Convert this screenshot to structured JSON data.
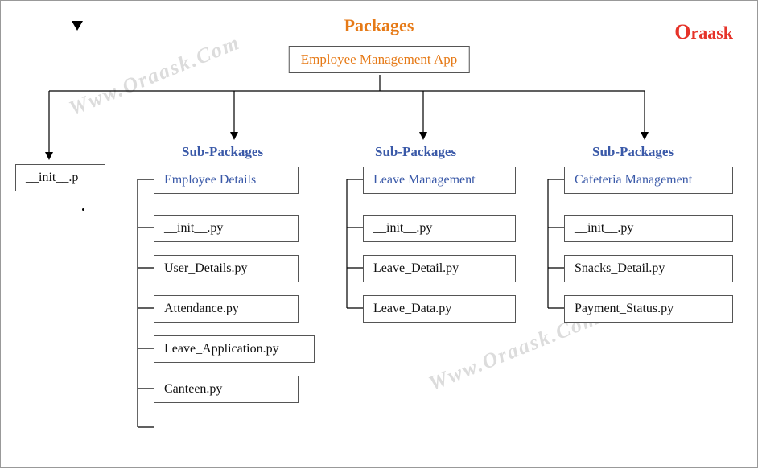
{
  "title": "Packages",
  "logo": "Oraask",
  "root": "Employee Management App",
  "watermark": "Www.Oraask.Com",
  "columns": {
    "init": {
      "file": "__init__.p"
    },
    "emp": {
      "heading": "Sub-Packages",
      "box": "Employee Details",
      "files": [
        "__init__.py",
        "User_Details.py",
        "Attendance.py",
        "Leave_Application.py",
        "Canteen.py"
      ]
    },
    "leave": {
      "heading": "Sub-Packages",
      "box": "Leave Management",
      "files": [
        "__init__.py",
        "Leave_Detail.py",
        "Leave_Data.py"
      ]
    },
    "cafe": {
      "heading": "Sub-Packages",
      "box": "Cafeteria Management",
      "files": [
        "__init__.py",
        "Snacks_Detail.py",
        "Payment_Status.py"
      ]
    }
  }
}
